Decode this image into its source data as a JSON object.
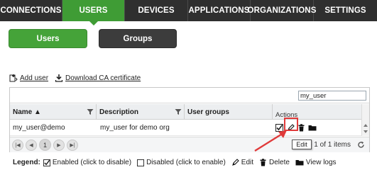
{
  "topnav": {
    "tabs": [
      {
        "label": "CONNECTIONS",
        "active": false
      },
      {
        "label": "USERS",
        "active": true
      },
      {
        "label": "DEVICES",
        "active": false
      },
      {
        "label": "APPLICATIONS",
        "active": false
      },
      {
        "label": "ORGANIZATIONS",
        "active": false
      },
      {
        "label": "SETTINGS",
        "active": false
      }
    ]
  },
  "subnav": {
    "users_label": "Users",
    "groups_label": "Groups"
  },
  "actions": {
    "add_user": "Add user",
    "download_ca": "Download CA certificate"
  },
  "grid": {
    "search_value": "my_user",
    "columns": {
      "name": "Name ▲",
      "description": "Description",
      "user_groups": "User groups",
      "actions": "Actions"
    },
    "rows": [
      {
        "name": "my_user@demo",
        "description": "my_user for demo org",
        "user_groups": ""
      }
    ],
    "pager": {
      "current_page": "1",
      "summary": "1 - 1 of 1 items"
    }
  },
  "tooltip": "Edit",
  "legend": {
    "title": "Legend:",
    "enabled": "Enabled (click to disable)",
    "disabled": "Disabled (click to enable)",
    "edit": "Edit",
    "delete": "Delete",
    "view_logs": "View logs"
  },
  "colors": {
    "nav_bg": "#2f2f2f",
    "accent_green": "#45a339",
    "highlight_red": "#e03a3a"
  },
  "icons": {
    "add_user": "add-user-icon",
    "download": "download-icon",
    "filter": "filter-icon",
    "checkbox_checked": "checkbox-checked-icon",
    "edit": "pencil-icon",
    "delete": "trash-icon",
    "view_logs": "folder-icon",
    "refresh": "refresh-icon"
  }
}
